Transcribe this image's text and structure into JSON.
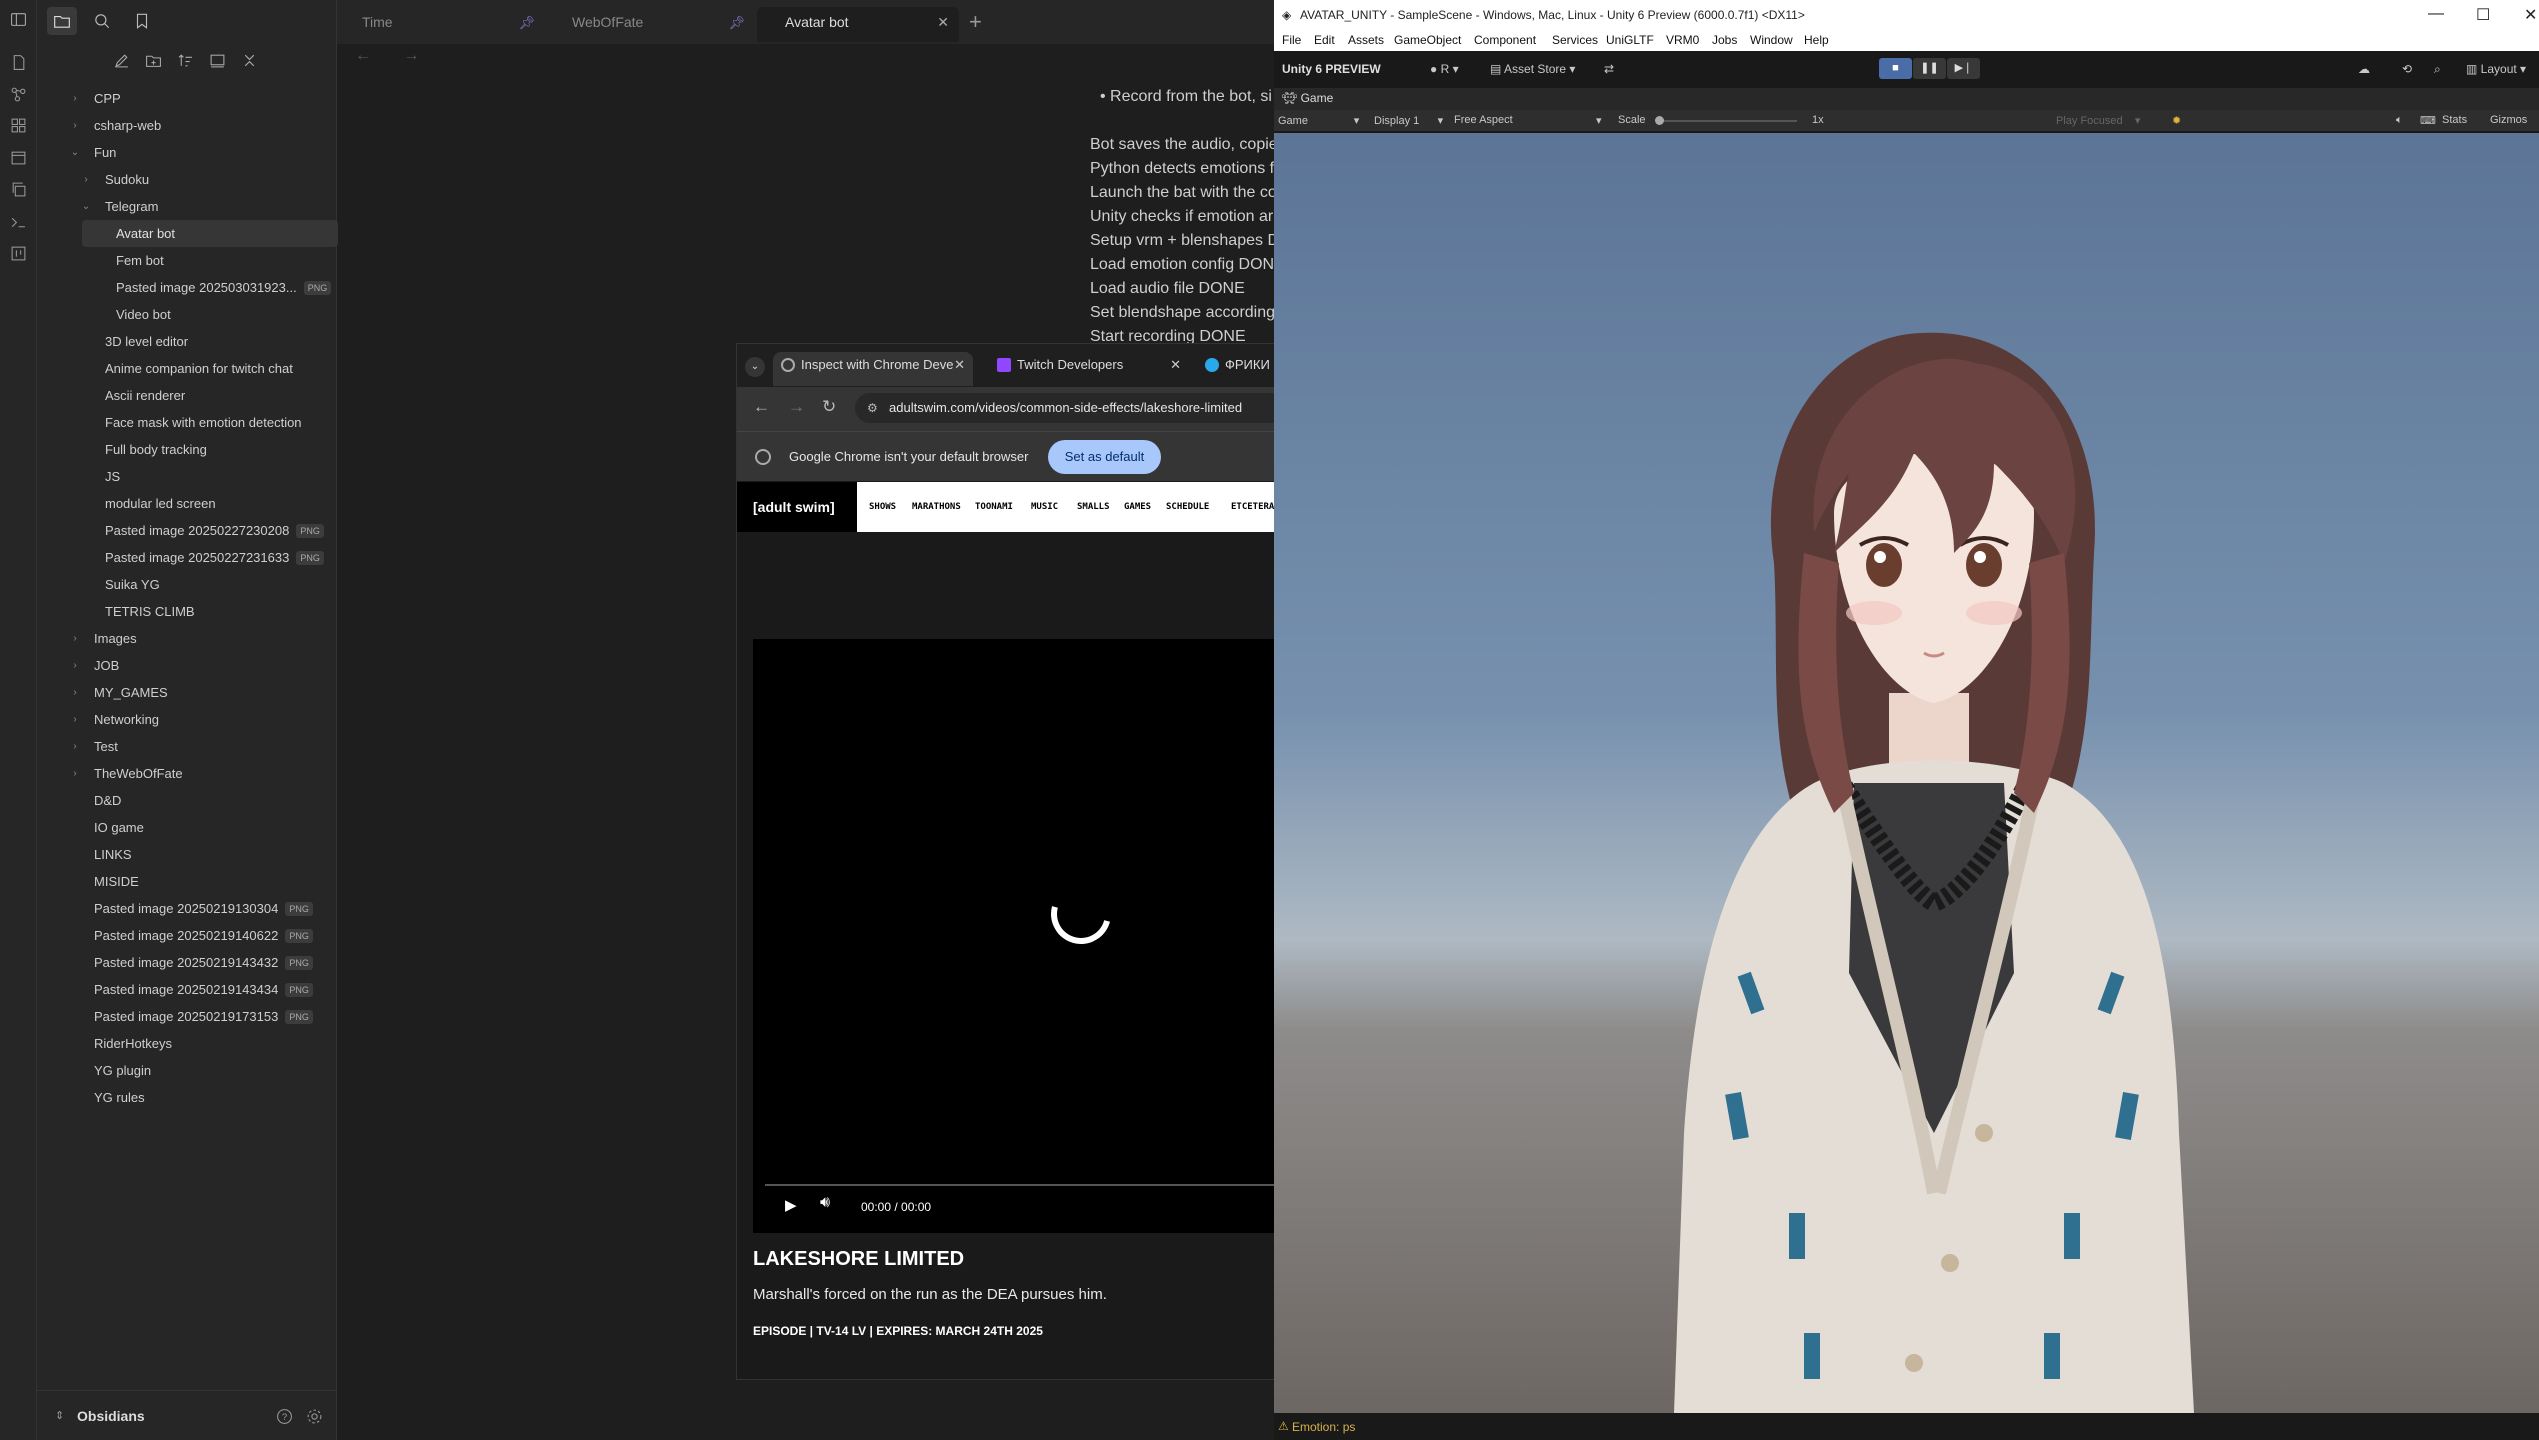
{
  "obsidian": {
    "tabs": [
      {
        "label": "Time",
        "pinned": true
      },
      {
        "label": "WebOfFate",
        "pinned": true
      },
      {
        "label": "Avatar bot",
        "pinned": false
      }
    ],
    "new_tab_glyph": "+",
    "nav_glyphs": "← →",
    "tree": [
      {
        "label": "CPP",
        "depth": 0,
        "chevron": "›"
      },
      {
        "label": "csharp-web",
        "depth": 0,
        "chevron": "›"
      },
      {
        "label": "Fun",
        "depth": 0,
        "chevron": "⌄"
      },
      {
        "label": "Sudoku",
        "depth": 1,
        "chevron": "›"
      },
      {
        "label": "Telegram",
        "depth": 1,
        "chevron": "⌄"
      },
      {
        "label": "Avatar bot",
        "depth": 2,
        "selected": true
      },
      {
        "label": "Fem bot",
        "depth": 2
      },
      {
        "label": "Pasted image 202503031923...",
        "depth": 2,
        "badge": "PNG"
      },
      {
        "label": "Video bot",
        "depth": 2
      },
      {
        "label": "3D level editor",
        "depth": 1
      },
      {
        "label": "Anime companion for twitch chat",
        "depth": 1
      },
      {
        "label": "Ascii renderer",
        "depth": 1
      },
      {
        "label": "Face mask with emotion detection",
        "depth": 1
      },
      {
        "label": "Full body tracking",
        "depth": 1
      },
      {
        "label": "JS",
        "depth": 1
      },
      {
        "label": "modular led screen",
        "depth": 1
      },
      {
        "label": "Pasted image 20250227230208",
        "depth": 1,
        "badge": "PNG"
      },
      {
        "label": "Pasted image 20250227231633",
        "depth": 1,
        "badge": "PNG"
      },
      {
        "label": "Suika YG",
        "depth": 1
      },
      {
        "label": "TETRIS CLIMB",
        "depth": 1
      },
      {
        "label": "Images",
        "depth": 0,
        "chevron": "›"
      },
      {
        "label": "JOB",
        "depth": 0,
        "chevron": "›"
      },
      {
        "label": "MY_GAMES",
        "depth": 0,
        "chevron": "›"
      },
      {
        "label": "Networking",
        "depth": 0,
        "chevron": "›"
      },
      {
        "label": "Test",
        "depth": 0,
        "chevron": "›"
      },
      {
        "label": "TheWebOfFate",
        "depth": 0,
        "chevron": "›"
      },
      {
        "label": "D&D",
        "depth": 0
      },
      {
        "label": "IO game",
        "depth": 0
      },
      {
        "label": "LINKS",
        "depth": 0
      },
      {
        "label": "MISIDE",
        "depth": 0
      },
      {
        "label": "Pasted image 20250219130304",
        "depth": 0,
        "badge": "PNG"
      },
      {
        "label": "Pasted image 20250219140622",
        "depth": 0,
        "badge": "PNG"
      },
      {
        "label": "Pasted image 20250219143432",
        "depth": 0,
        "badge": "PNG"
      },
      {
        "label": "Pasted image 20250219143434",
        "depth": 0,
        "badge": "PNG"
      },
      {
        "label": "Pasted image 20250219173153",
        "depth": 0,
        "badge": "PNG"
      },
      {
        "label": "RiderHotkeys",
        "depth": 0
      },
      {
        "label": "YG plugin",
        "depth": 0
      },
      {
        "label": "YG rules",
        "depth": 0
      }
    ],
    "vault_name": "Obsidians",
    "note_lines": [
      "• Record from the bot, si",
      "Bot saves the audio, copie",
      "Python detects emotions f",
      "Launch the bat with the co",
      "Unity checks if emotion ar",
      "Setup vrm + blenshapes D",
      "Load emotion config DON",
      "Load audio file DONE",
      "Set blendshape according",
      "Start recording DONE"
    ]
  },
  "chrome": {
    "tab_dropdown": "⌄",
    "tabs": [
      {
        "label": "Inspect with Chrome Deve",
        "active": true
      },
      {
        "label": "Twitch Developers"
      },
      {
        "label": "ФРИКИ"
      }
    ],
    "url": "adultswim.com/videos/common-side-effects/lakeshore-limited",
    "infobar_text": "Google Chrome isn't your default browser",
    "set_default_label": "Set as default",
    "site_logo": "[adult swim]",
    "nav_items": [
      "SHOWS",
      "MARATHONS",
      "TOONAMI",
      "MUSIC",
      "SMALLS",
      "GAMES",
      "SCHEDULE",
      "ETCETERA"
    ],
    "video_time": "00:00 / 00:00",
    "episode_title": "LAKESHORE LIMITED",
    "episode_desc": "Marshall's forced on the run as the DEA pursues him.",
    "episode_meta": "EPISODE  |  TV-14 LV  |  EXPIRES: MARCH 24TH 2025"
  },
  "unity": {
    "window_title": "AVATAR_UNITY - SampleScene - Windows, Mac, Linux - Unity 6 Preview (6000.0.7f1) <DX11>",
    "menu": [
      "File",
      "Edit",
      "Assets",
      "GameObject",
      "Component",
      "Services",
      "UniGLTF",
      "VRM0",
      "Jobs",
      "Window",
      "Help"
    ],
    "toolbar": {
      "logo": "Unity 6 PREVIEW",
      "account": "R",
      "asset_store": "Asset Store",
      "layout": "Layout"
    },
    "game_tab": "Game",
    "gamebar": {
      "view": "Game",
      "display": "Display 1",
      "aspect": "Free Aspect",
      "scale_label": "Scale",
      "scale_value": "1x",
      "play_focused": "Play Focused",
      "stats": "Stats",
      "gizmos": "Gizmos"
    },
    "status": "Emotion: ps",
    "colors": {
      "sky_top": "#5c7597",
      "horizon": "#aeb9c3",
      "floor": "#6d6763",
      "play_active": "#4a6da7"
    }
  }
}
